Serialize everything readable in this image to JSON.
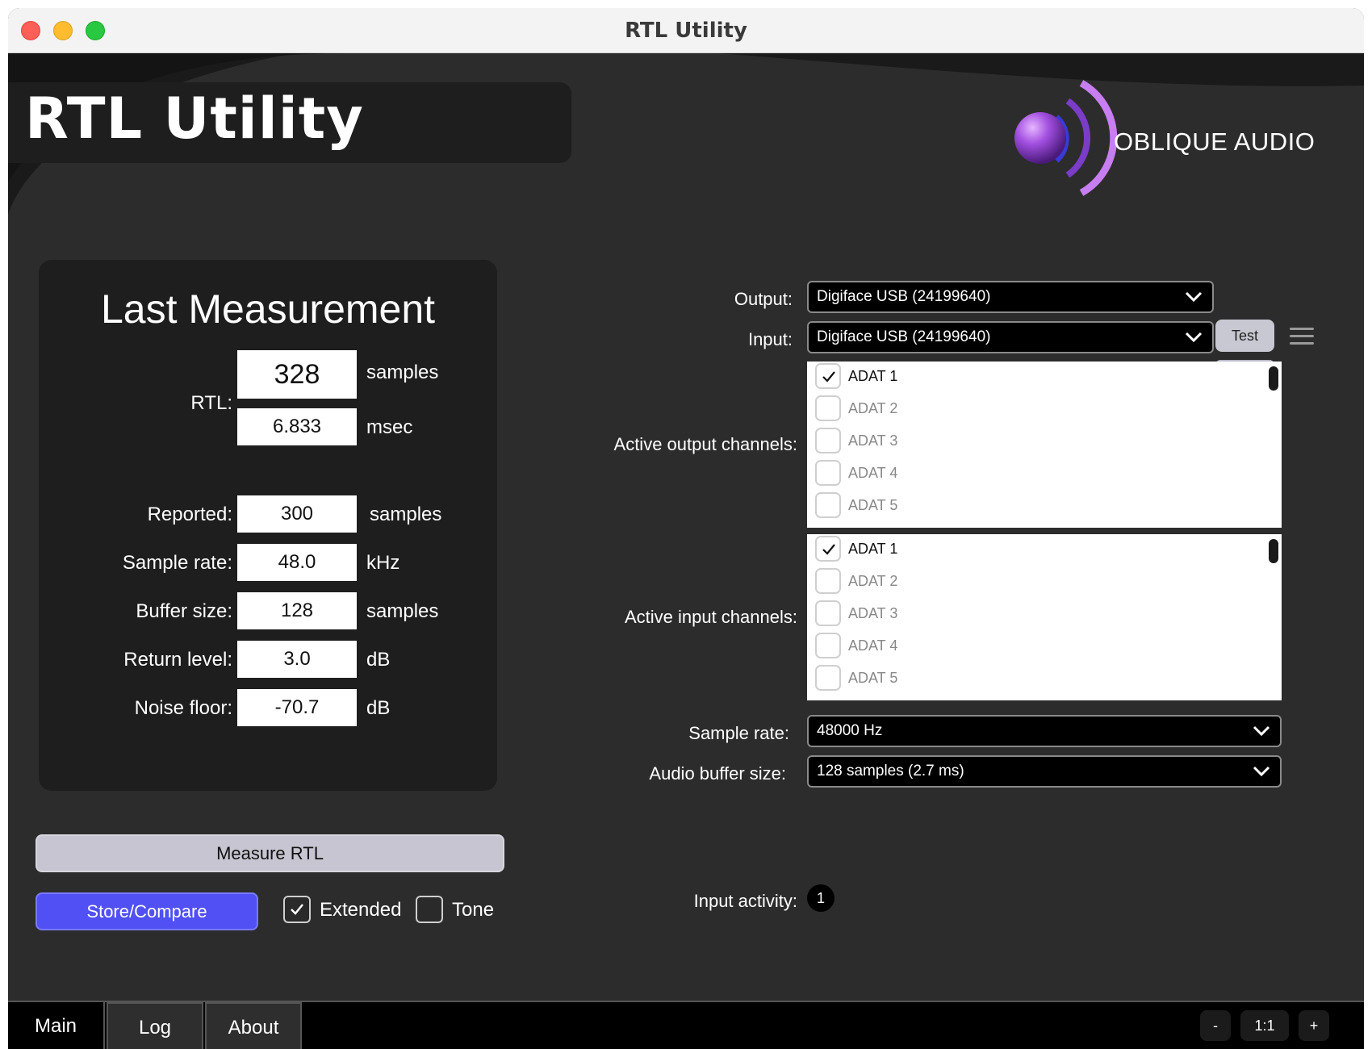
{
  "window": {
    "title": "RTL Utility"
  },
  "header": {
    "app_title": "RTL Utility",
    "brand": "OBLIQUE AUDIO"
  },
  "measurement": {
    "title": "Last Measurement",
    "rtl_label": "RTL:",
    "rtl_samples": "328",
    "rtl_samples_unit": "samples",
    "rtl_msec": "6.833",
    "rtl_msec_unit": "msec",
    "rows": [
      {
        "label": "Reported:",
        "value": "300",
        "unit": "samples"
      },
      {
        "label": "Sample rate:",
        "value": "48.0",
        "unit": "kHz"
      },
      {
        "label": "Buffer size:",
        "value": "128",
        "unit": "samples"
      },
      {
        "label": "Return level:",
        "value": "3.0",
        "unit": "dB"
      },
      {
        "label": "Noise floor:",
        "value": "-70.7",
        "unit": "dB"
      }
    ]
  },
  "actions": {
    "measure_label": "Measure RTL",
    "store_label": "Store/Compare",
    "extended_label": "Extended",
    "extended_checked": true,
    "tone_label": "Tone",
    "tone_checked": false
  },
  "settings": {
    "output_label": "Output:",
    "output_value": "Digiface USB (24199640)",
    "test_label": "Test",
    "input_label": "Input:",
    "input_value": "Digiface USB (24199640)",
    "active_output_label": "Active output channels:",
    "active_input_label": "Active input channels:",
    "output_channels": [
      {
        "name": "ADAT 1",
        "checked": true
      },
      {
        "name": "ADAT 2",
        "checked": false
      },
      {
        "name": "ADAT 3",
        "checked": false
      },
      {
        "name": "ADAT 4",
        "checked": false
      },
      {
        "name": "ADAT 5",
        "checked": false
      }
    ],
    "input_channels": [
      {
        "name": "ADAT 1",
        "checked": true
      },
      {
        "name": "ADAT 2",
        "checked": false
      },
      {
        "name": "ADAT 3",
        "checked": false
      },
      {
        "name": "ADAT 4",
        "checked": false
      },
      {
        "name": "ADAT 5",
        "checked": false
      }
    ],
    "sample_rate_label": "Sample rate:",
    "sample_rate_value": "48000 Hz",
    "buffer_label": "Audio buffer size:",
    "buffer_value": "128 samples (2.7 ms)",
    "activity_label": "Input activity:",
    "activity_value": "1"
  },
  "tabs": [
    {
      "label": "Main",
      "active": true
    },
    {
      "label": "Log",
      "active": false
    },
    {
      "label": "About",
      "active": false
    }
  ],
  "zoom": {
    "minus": "-",
    "level": "1:1",
    "plus": "+"
  },
  "colors": {
    "accent_blue": "#5050f5",
    "logo_purple": "#9b45d8",
    "panel_dark": "#1e1e1e"
  },
  "icons": {
    "dropdown": "chevron-down-icon",
    "menu": "hamburger-icon",
    "check": "checkmark-icon"
  }
}
